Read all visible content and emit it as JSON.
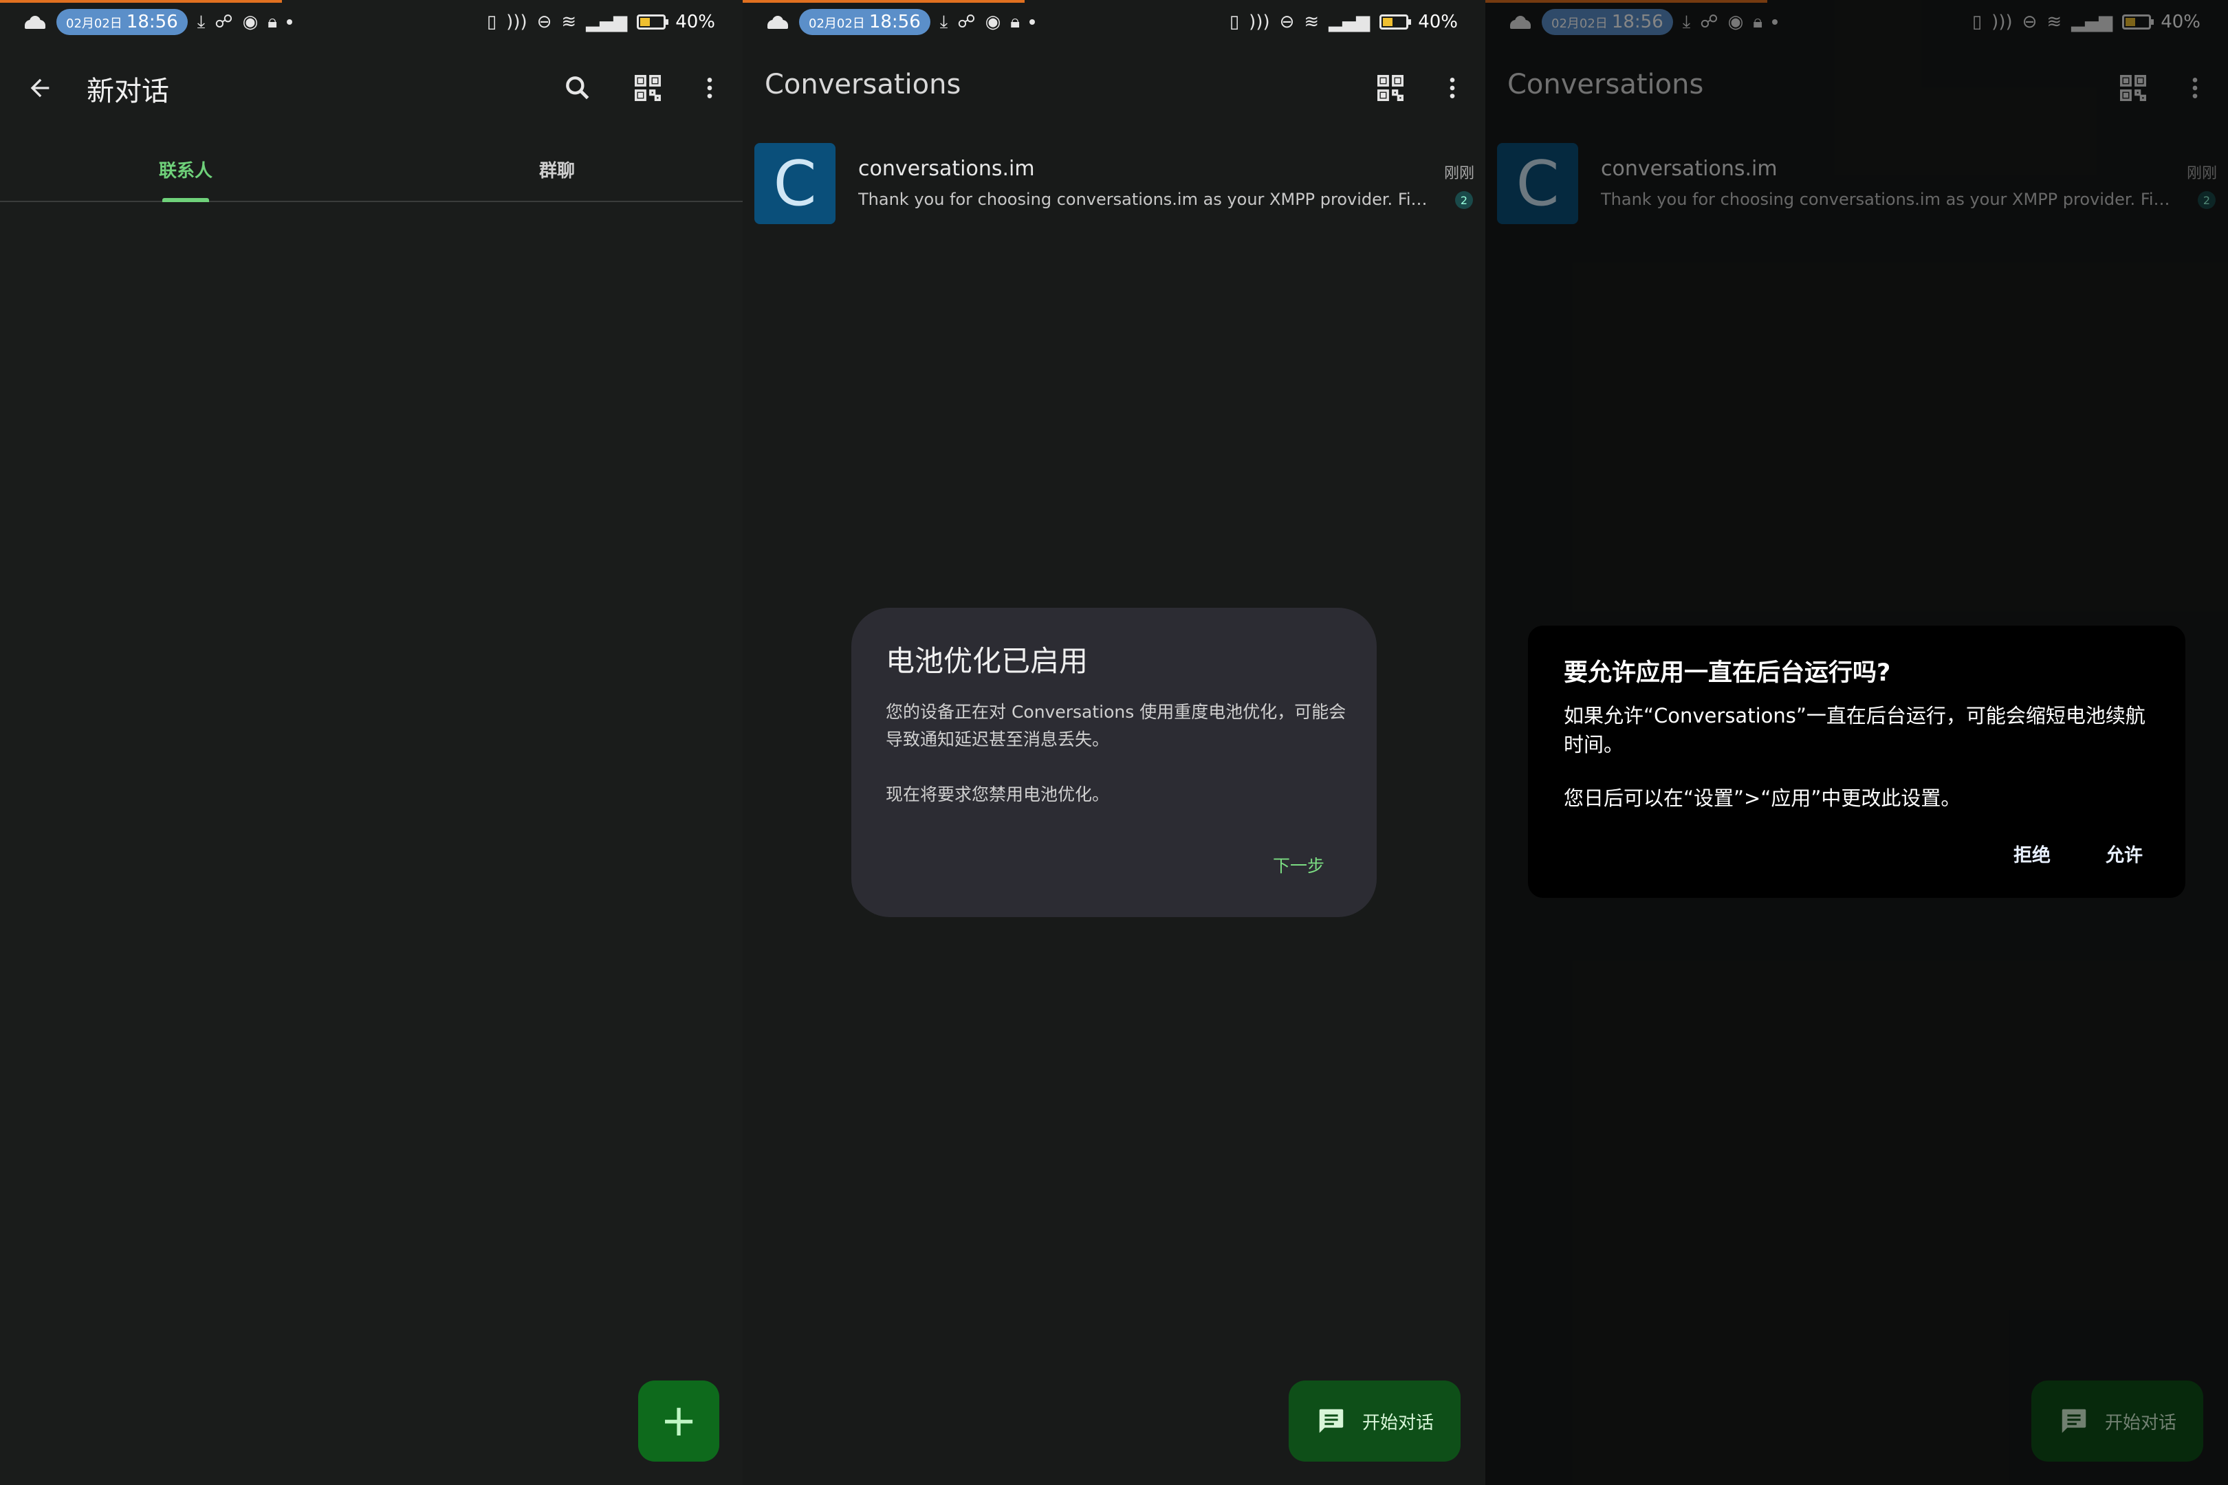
{
  "status_bar": {
    "date": "02月02日",
    "time": "18:56",
    "battery": "40%",
    "battery_level": 0.4,
    "icons": [
      "cloud-icon",
      "download-icon",
      "hotspot-icon",
      "record-icon",
      "lock-icon",
      "dot-icon",
      "phone-icon",
      "nfc-icon",
      "dnd-icon",
      "wifi-icon",
      "signal-icon",
      "battery-icon"
    ]
  },
  "screen1": {
    "title": "新对话",
    "tabs": [
      {
        "label": "联系人",
        "active": true
      },
      {
        "label": "群聊",
        "active": false
      }
    ],
    "fab_icon": "add-icon",
    "fab_label": "+"
  },
  "screen2": {
    "title": "Conversations",
    "conversation": {
      "avatar_letter": "C",
      "name": "conversations.im",
      "time": "刚刚",
      "preview": "Thank you for choosing conversations.im as your XMPP provider. Find out how to get the most out of it",
      "unread": "2"
    },
    "dialog": {
      "title": "电池优化已启用",
      "body": "您的设备正在对 Conversations 使用重度电池优化，可能会导致通知延迟甚至消息丢失。",
      "body2": "现在将要求您禁用电池优化。",
      "next": "下一步"
    },
    "fab_label": "开始对话"
  },
  "screen3": {
    "title": "Conversations",
    "conversation": {
      "avatar_letter": "C",
      "name": "conversations.im",
      "time": "刚刚",
      "preview": "Thank you for choosing conversations.im as your XMPP provider. Find out how to get the most out of it",
      "unread": "2"
    },
    "dialog": {
      "title": "要允许应用一直在后台运行吗?",
      "body": "如果允许“Conversations”一直在后台运行，可能会缩短电池续航时间。",
      "body2": "您日后可以在“设置”>“应用”中更改此设置。",
      "deny": "拒绝",
      "allow": "允许"
    },
    "fab_label": "开始对话"
  },
  "colors": {
    "accent_green": "#6fd17a",
    "fab_green": "#0e6a1c",
    "avatar_blue": "#0a4f7a",
    "time_pill": "#5b8fc9"
  }
}
